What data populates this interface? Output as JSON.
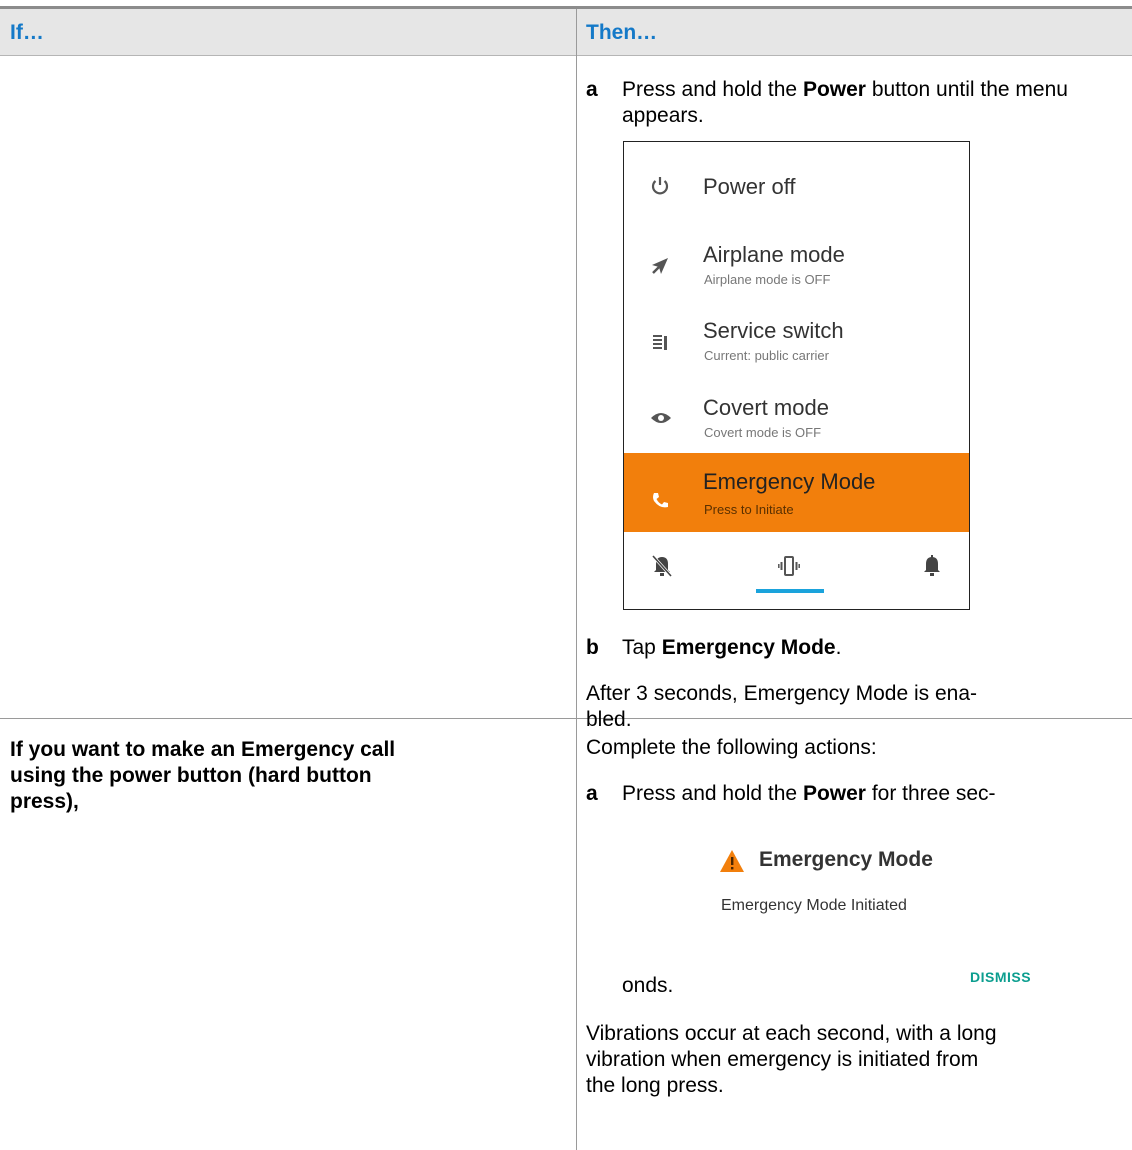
{
  "table": {
    "headers": [
      "If…",
      "Then…"
    ],
    "row1": {
      "step_a": {
        "letter": "a",
        "pre": "Press and hold the ",
        "bold": "Power",
        "post": " button until the menu appears."
      },
      "menu": {
        "items": [
          {
            "label": "Power off",
            "sub": "",
            "icon": "power-icon"
          },
          {
            "label": "Airplane mode",
            "sub": "Airplane mode is OFF",
            "icon": "airplane-icon"
          },
          {
            "label": "Service switch",
            "sub": "Current: public carrier",
            "icon": "service-switch-icon"
          },
          {
            "label": "Covert mode",
            "sub": "Covert mode is OFF",
            "icon": "eye-icon"
          },
          {
            "label": "Emergency Mode",
            "sub": "Press to Initiate",
            "icon": "phone-icon"
          }
        ],
        "bottom_icons": [
          "silent-bell-icon",
          "vibrate-icon",
          "bell-icon"
        ],
        "highlight_color": "#f27f0c",
        "selected_indicator_color": "#1aa3dc"
      },
      "step_b": {
        "letter": "b",
        "pre": "Tap ",
        "bold": "Emergency Mode",
        "post": "."
      },
      "note_line1": "After 3 seconds, Emergency Mode is ena-",
      "note_line2": "bled."
    },
    "row2": {
      "if_line1": "If you want to make an Emergency call",
      "if_line2": "using the power button (hard button",
      "if_line3": "press),",
      "intro": "Complete the following actions:",
      "step_a": {
        "letter": "a",
        "pre": "Press and hold the ",
        "bold": "Power",
        "post": " for three sec-",
        "cont": "onds."
      },
      "notification": {
        "title": "Emergency Mode",
        "text": "Emergency Mode Initiated",
        "button": "DISMISS",
        "icon": "warning-icon",
        "warning_color": "#f27f0c",
        "button_color": "#0c9e8f"
      },
      "vib_line1": "Vibrations occur at each second, with a long",
      "vib_line2": "vibration when emergency is initiated from",
      "vib_line3": "the long press."
    }
  }
}
